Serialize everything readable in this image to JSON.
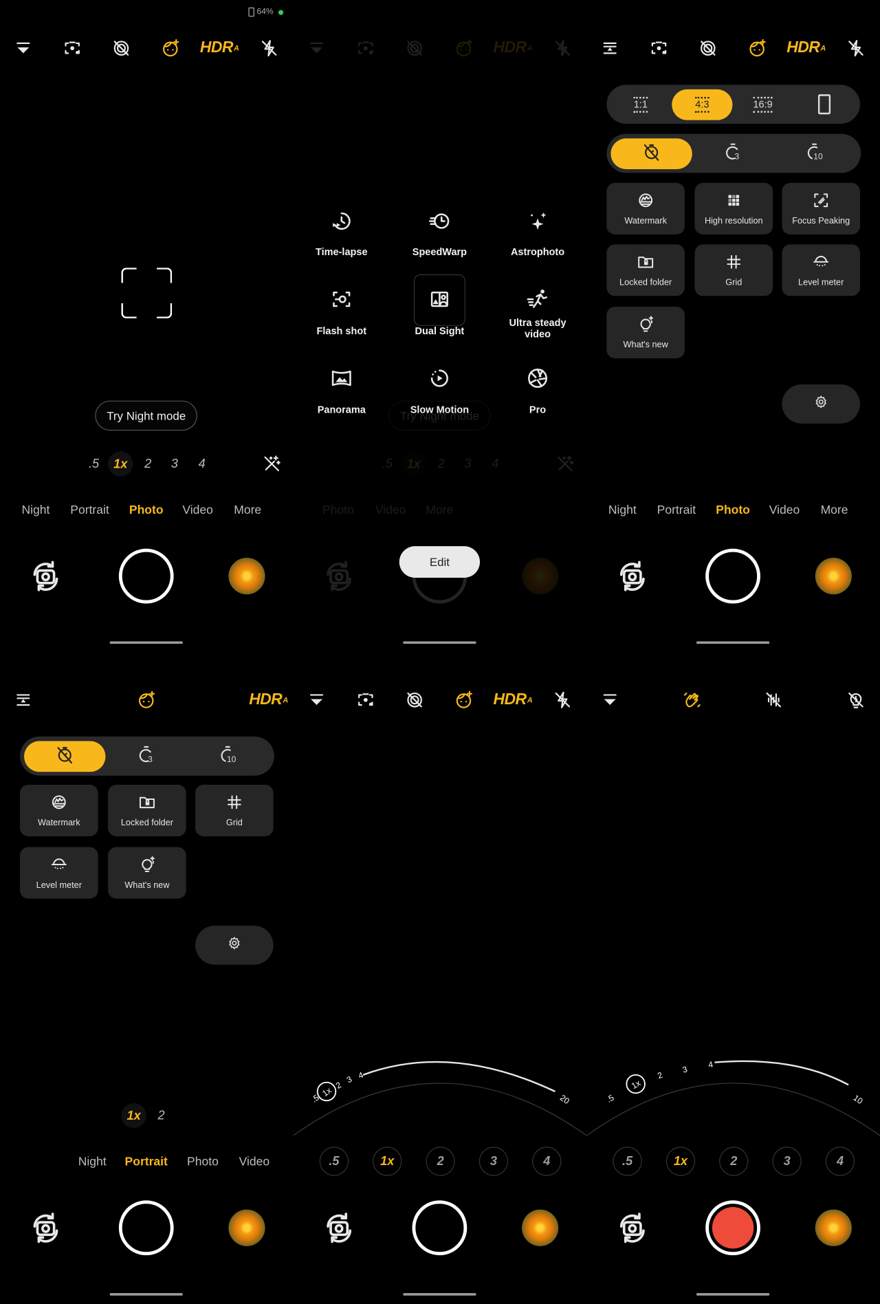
{
  "status": {
    "battery": "64%",
    "battery_icon": "battery-icon",
    "dot_color": "#34c759"
  },
  "colors": {
    "accent": "#f8b81c",
    "record": "#ef4b3a",
    "tile": "#262626"
  },
  "hdr": {
    "label": "HDR",
    "suffix": "A"
  },
  "modes_full": [
    "Night",
    "Portrait",
    "Photo",
    "Video",
    "More"
  ],
  "zoom_levels": [
    ".5",
    "1x",
    "2",
    "3",
    "4"
  ],
  "panels": [
    {
      "topbar": [
        "menu-collapse-icon",
        "lens-scan-icon",
        "motion-off-icon",
        "beauty-face-icon",
        "hdr",
        "flash-off-icon"
      ],
      "night_hint": "Try Night mode",
      "selected_mode": "Photo",
      "selected_zoom": "1x"
    },
    {
      "mode_menu": [
        {
          "label": "Time-lapse",
          "icon": "timelapse-icon"
        },
        {
          "label": "SpeedWarp",
          "icon": "speedwarp-icon"
        },
        {
          "label": "Astrophoto",
          "icon": "sparkles-icon"
        },
        {
          "label": "Flash shot",
          "icon": "flash-shot-icon"
        },
        {
          "label": "Dual Sight",
          "icon": "dual-sight-icon"
        },
        {
          "label": "Ultra steady video",
          "icon": "runner-icon"
        },
        {
          "label": "Panorama",
          "icon": "panorama-icon"
        },
        {
          "label": "Slow Motion",
          "icon": "slow-motion-icon"
        },
        {
          "label": "Pro",
          "icon": "aperture-icon"
        }
      ],
      "dim_modes": [
        "Photo",
        "Video",
        "More"
      ],
      "night_hint": "Try Night mode",
      "edit_label": "Edit"
    },
    {
      "aspect_ratios": [
        "1:1",
        "4:3",
        "16:9",
        "Full"
      ],
      "selected_aspect": "4:3",
      "timers": [
        "off",
        "3",
        "10"
      ],
      "selected_timer": "off",
      "tiles": [
        "Watermark",
        "High resolution",
        "Focus Peaking",
        "Locked folder",
        "Grid",
        "Level meter",
        "What's new"
      ],
      "settings_icon": "gear-icon",
      "selected_mode": "Photo"
    },
    {
      "timers": [
        "off",
        "3",
        "10"
      ],
      "selected_timer": "off",
      "tiles": [
        "Watermark",
        "Locked folder",
        "Grid",
        "Level meter",
        "What's new"
      ],
      "zoom": [
        "1x",
        "2"
      ],
      "modes": [
        "Night",
        "Portrait",
        "Photo",
        "Video"
      ],
      "selected_mode": "Portrait"
    },
    {
      "dial_labels": [
        ".5",
        "1x",
        "2",
        "3",
        "4",
        "20"
      ],
      "selected_zoom": "1x"
    },
    {
      "topbar": [
        "menu-collapse-icon",
        "stabilization-icon",
        "audio-off-icon",
        "light-off-icon"
      ],
      "dial_labels": [
        ".5",
        "1x",
        "2",
        "3",
        "4",
        "10"
      ],
      "selected_zoom": "1x",
      "recording": true
    }
  ]
}
